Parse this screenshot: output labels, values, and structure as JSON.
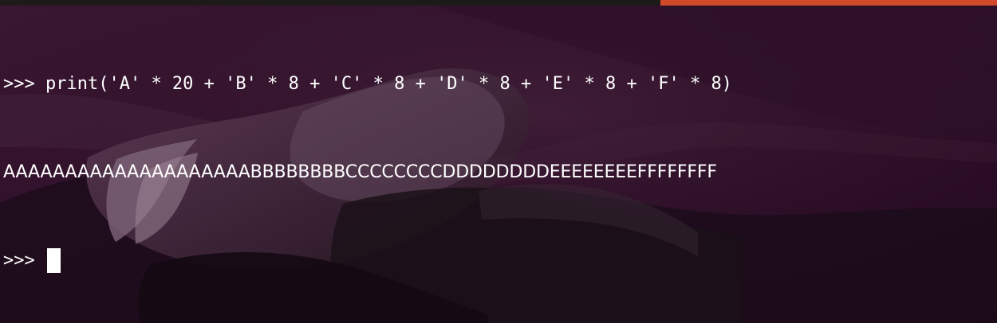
{
  "colors": {
    "background": "#300a24",
    "text": "#ffffff",
    "cursor": "#ffffff",
    "accent": "#d04a2a"
  },
  "terminal": {
    "lines": [
      {
        "prompt": ">>>",
        "command": " print('A' * 20 + 'B' * 8 + 'C' * 8 + 'D' * 8 + 'E' * 8 + 'F' * 8)"
      },
      {
        "output": "AAAAAAAAAAAAAAAAAAAABBBBBBBBCCCCCCCCDDDDDDDDEEEEEEEEFFFFFFFF"
      },
      {
        "prompt": ">>>"
      }
    ]
  }
}
